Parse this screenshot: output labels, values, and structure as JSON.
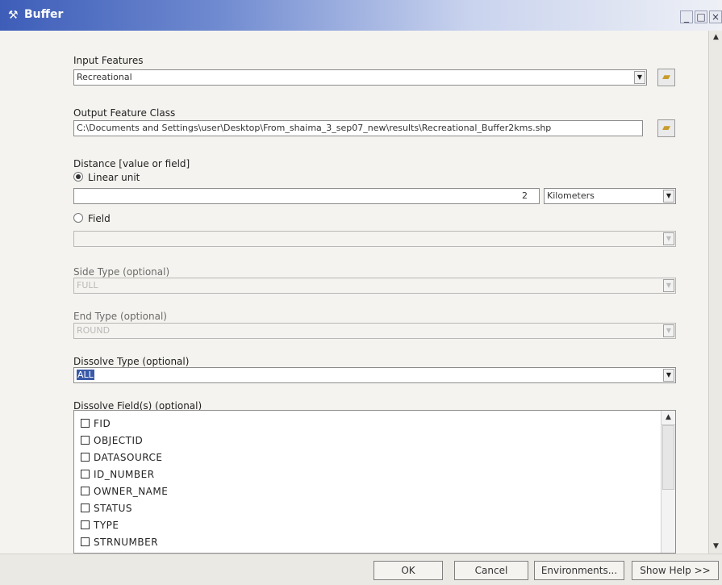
{
  "window": {
    "title": "Buffer",
    "minimize_label": "_",
    "maximize_label": "□",
    "close_label": "×"
  },
  "form": {
    "input_features": {
      "label": "Input Features",
      "value": "Recreational"
    },
    "output_feature_class": {
      "label": "Output Feature Class",
      "value": "C:\\Documents and Settings\\user\\Desktop\\From_shaima_3_sep07_new\\results\\Recreational_Buffer2kms.shp"
    },
    "distance": {
      "label": "Distance [value or field]",
      "linear_unit_label": "Linear unit",
      "linear_value": "2",
      "unit": "Kilometers",
      "field_label": "Field",
      "field_value": ""
    },
    "side_type": {
      "label": "Side Type (optional)",
      "value": "FULL"
    },
    "end_type": {
      "label": "End Type (optional)",
      "value": "ROUND"
    },
    "dissolve_type": {
      "label": "Dissolve Type (optional)",
      "value": "ALL"
    },
    "dissolve_fields": {
      "label": "Dissolve Field(s) (optional)",
      "items": [
        "FID",
        "OBJECTID",
        "DATASOURCE",
        "ID_NUMBER",
        "OWNER_NAME",
        "STATUS",
        "TYPE",
        "STRNUMBER"
      ]
    }
  },
  "buttons": {
    "ok": "OK",
    "cancel": "Cancel",
    "environments": "Environments...",
    "show_help": "Show Help >>"
  }
}
